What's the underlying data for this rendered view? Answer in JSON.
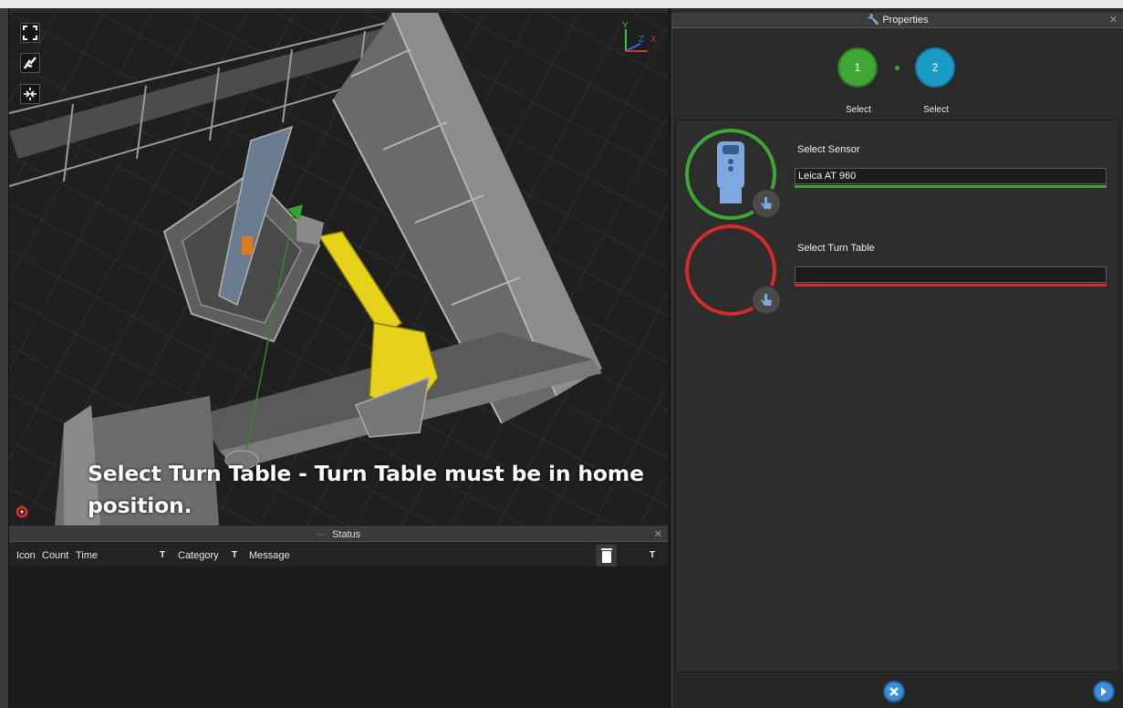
{
  "viewport": {
    "tools": [
      "fullscreen-icon",
      "hand-tool-icon",
      "fit-view-icon"
    ],
    "axes": [
      "Y",
      "Z",
      "X"
    ],
    "overlay_message": "Select Turn Table - Turn Table must be in home position."
  },
  "status": {
    "title": "Status",
    "columns": [
      "Icon",
      "Count",
      "Time",
      "Category",
      "Message"
    ],
    "rows": []
  },
  "properties": {
    "title": "Properties",
    "steps": [
      {
        "number": "1",
        "label": "Select",
        "color": "#3fa536"
      },
      {
        "number": "2",
        "label": "Select",
        "color": "#1a9ac7"
      }
    ],
    "sensor": {
      "label": "Select Sensor",
      "value": "Leica AT 960",
      "status_color": "#3fa536"
    },
    "turntable": {
      "label": "Select Turn Table",
      "value": "",
      "status_color": "#d32a2a"
    },
    "footer_buttons": [
      "cancel-icon",
      "next-icon"
    ]
  },
  "colors": {
    "accent_green": "#3fa536",
    "accent_red": "#d32a2a",
    "accent_blue": "#1a9ac7"
  }
}
